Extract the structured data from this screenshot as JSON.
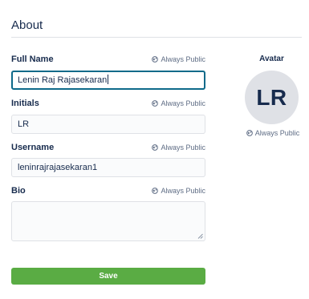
{
  "section": {
    "title": "About"
  },
  "visibility_label": "Always Public",
  "fields": {
    "full_name": {
      "label": "Full Name",
      "value": "Lenin Raj Rajasekaran"
    },
    "initials": {
      "label": "Initials",
      "value": "LR"
    },
    "username": {
      "label": "Username",
      "value": "leninrajrajasekaran1"
    },
    "bio": {
      "label": "Bio",
      "value": ""
    }
  },
  "avatar": {
    "label": "Avatar",
    "initials": "LR"
  },
  "actions": {
    "save_label": "Save"
  },
  "colors": {
    "save_button": "#5aac44",
    "focus_border": "#0f6a8a",
    "avatar_bg": "#dfe1e6",
    "text": "#172b4d",
    "muted": "#5e6c84"
  },
  "icons": {
    "visibility": "globe-icon",
    "resize": "resize-handle-icon"
  }
}
